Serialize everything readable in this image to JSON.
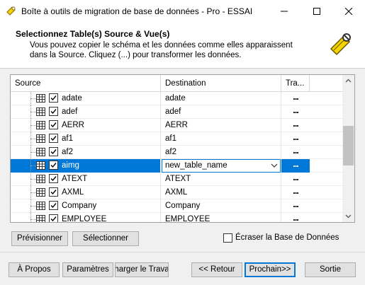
{
  "window": {
    "title": "Boîte à outils de migration de base de données - Pro - ESSAI"
  },
  "header": {
    "title": "Selectionnez Table(s) Source & Vue(s)",
    "description": "Vous pouvez copier le schéma et les données comme elles apparaissent dans la Source. Cliquez (...) pour transformer les données."
  },
  "grid": {
    "columns": [
      "Source",
      "Destination",
      "Tra..."
    ],
    "rows": [
      {
        "source": "adate",
        "destination": "adate",
        "checked": true
      },
      {
        "source": "adef",
        "destination": "adef",
        "checked": true
      },
      {
        "source": "AERR",
        "destination": "AERR",
        "checked": true
      },
      {
        "source": "af1",
        "destination": "af1",
        "checked": true
      },
      {
        "source": "af2",
        "destination": "af2",
        "checked": true
      },
      {
        "source": "aimg",
        "destination": "new_table_name",
        "checked": true,
        "selected": true
      },
      {
        "source": "ATEXT",
        "destination": "ATEXT",
        "checked": true
      },
      {
        "source": "AXML",
        "destination": "AXML",
        "checked": true
      },
      {
        "source": "Company",
        "destination": "Company",
        "checked": true
      },
      {
        "source": "EMPLOYEE",
        "destination": "EMPLOYEE",
        "checked": true
      }
    ],
    "transform_label": "..."
  },
  "actions": {
    "preview": "Prévisionner",
    "select": "Sélectionner",
    "overwrite_label": "Écraser la Base de Données",
    "overwrite_checked": false
  },
  "footer": {
    "about": "À Propos",
    "settings": "Paramètres",
    "load_task": "Charger le Travail",
    "back": "<< Retour",
    "next": "Prochain>>",
    "exit": "Sortie"
  },
  "colors": {
    "selection": "#0078d7",
    "button_face": "#e1e1e1",
    "logo_yellow": "#f5d400"
  },
  "icons": [
    "app-icon",
    "minimize-icon",
    "maximize-icon",
    "close-icon",
    "wizard-logo-icon",
    "table-icon",
    "checkbox-icon",
    "dropdown-caret-icon",
    "scroll-up-icon",
    "scroll-down-icon"
  ]
}
